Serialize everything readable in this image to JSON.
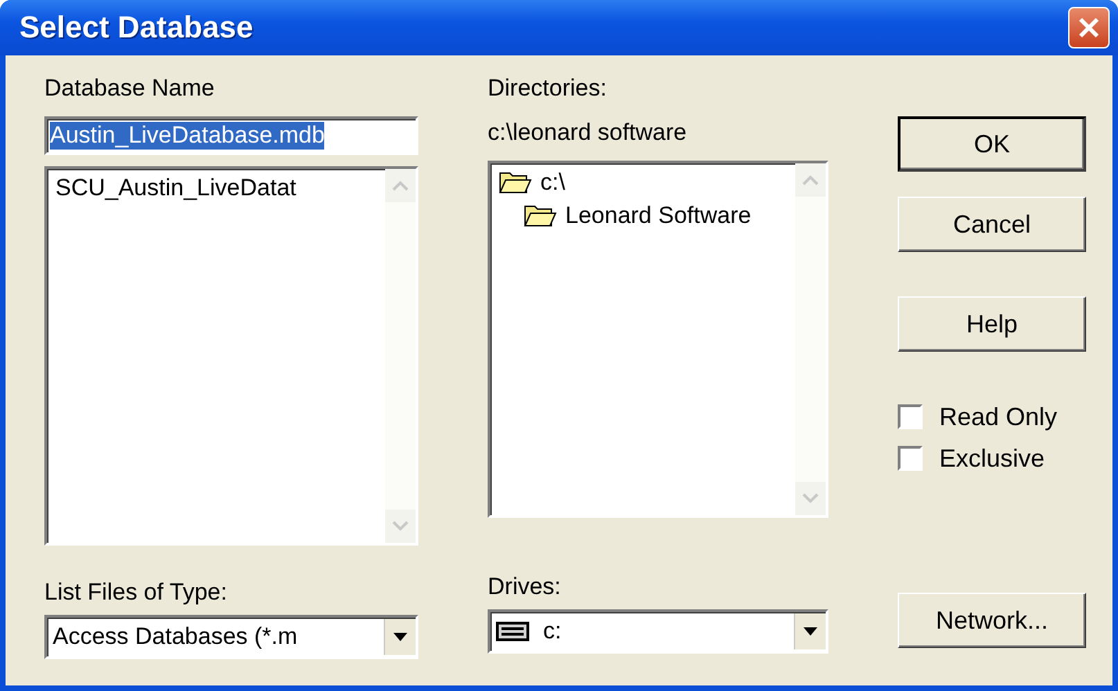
{
  "window": {
    "title": "Select Database"
  },
  "database_name": {
    "label": "Database Name",
    "value": "Austin_LiveDatabase.mdb",
    "selected": true
  },
  "files": [
    {
      "name": "SCU_Austin_LiveDatat",
      "selected": false
    }
  ],
  "directories": {
    "label": "Directories:",
    "path": "c:\\leonard software",
    "items": [
      {
        "name": "c:\\",
        "expanded": true,
        "children": [
          {
            "name": "Leonard Software",
            "expanded": true
          }
        ]
      }
    ]
  },
  "file_type": {
    "label": "List Files of Type:",
    "value": "Access Databases (*.m"
  },
  "drives": {
    "label": "Drives:",
    "value": "c:"
  },
  "buttons": [
    {
      "label": "OK",
      "default": true
    },
    {
      "label": "Cancel",
      "default": false
    },
    {
      "label": "Help",
      "default": false
    }
  ],
  "options": [
    {
      "label": "Read Only",
      "checked": false
    },
    {
      "label": "Exclusive",
      "checked": false
    }
  ],
  "network_button": {
    "label": "Network..."
  }
}
